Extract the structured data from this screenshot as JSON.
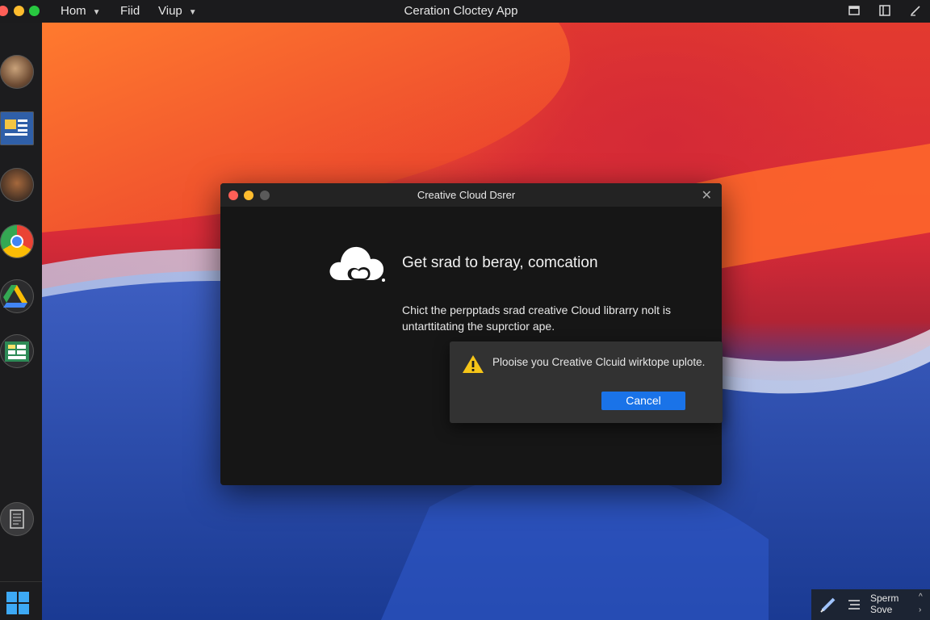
{
  "menubar": {
    "items": [
      {
        "label": "Hom"
      },
      {
        "label": "Fiid"
      },
      {
        "label": "Viup"
      }
    ],
    "app_title": "Ceration Cloctey App",
    "right_icons": [
      "window-icon",
      "sidebar-toggle-icon",
      "pen-icon"
    ]
  },
  "dock": {
    "icons": [
      "avatar-icon",
      "document-app-icon",
      "guitar-app-icon",
      "chrome-icon",
      "drive-icon",
      "spreadsheet-icon",
      "notes-icon"
    ]
  },
  "dialog": {
    "title": "Creative Cloud Dsrer",
    "headline": "Get srad to beray, comcation",
    "body": "Chict the perpptads srad creative Cloud librarry nolt is untarttitating the suprctior ape.",
    "icon": "creative-cloud-icon"
  },
  "alert": {
    "message": "Plooise you Creative Clcuid wirktope uplote.",
    "button_label": "Cancel",
    "icon": "warning-icon"
  },
  "tray": {
    "label_line1": "Sperm",
    "label_line2": "Sove"
  },
  "colors": {
    "accent": "#1a73e8",
    "warning": "#f5c518",
    "close_red": "#ff5f57",
    "minimize_yellow": "#febc2e",
    "zoom_green": "#28c840"
  }
}
